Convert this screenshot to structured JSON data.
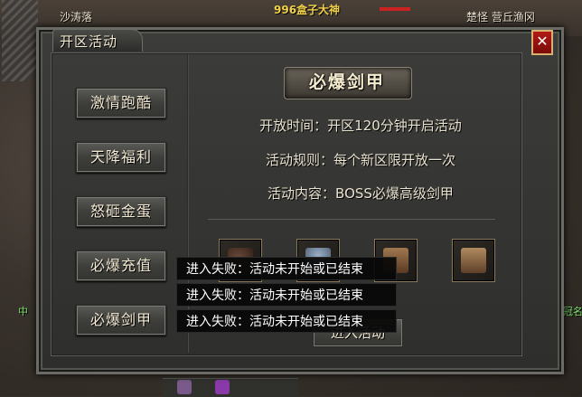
{
  "scene": {
    "top_center_name": "996盒子大神",
    "top_left_name": "沙涛落",
    "top_right_name": "楚怪 营丘渔冈",
    "left_green": "中",
    "right_green": "冠名"
  },
  "panel": {
    "title": "开区活动",
    "close_label": "✕"
  },
  "menu": [
    {
      "label": "激情跑酷"
    },
    {
      "label": "天降福利"
    },
    {
      "label": "怒砸金蛋"
    },
    {
      "label": "必爆充值"
    },
    {
      "label": "必爆剑甲"
    }
  ],
  "activity": {
    "heading": "必爆剑甲",
    "open_time": "开放时间：开区120分钟开启活动",
    "rules": "活动规则：每个新区限开放一次",
    "content": "活动内容：BOSS必爆高级剑甲",
    "enter_button": "进入活动"
  },
  "toasts": [
    "进入失败：活动未开始或已结束",
    "进入失败：活动未开始或已结束",
    "进入失败：活动未开始或已结束"
  ],
  "colors": {
    "close": "#b11a16",
    "heading_text": "#f5ecd0",
    "toast_bg": "#080808"
  }
}
